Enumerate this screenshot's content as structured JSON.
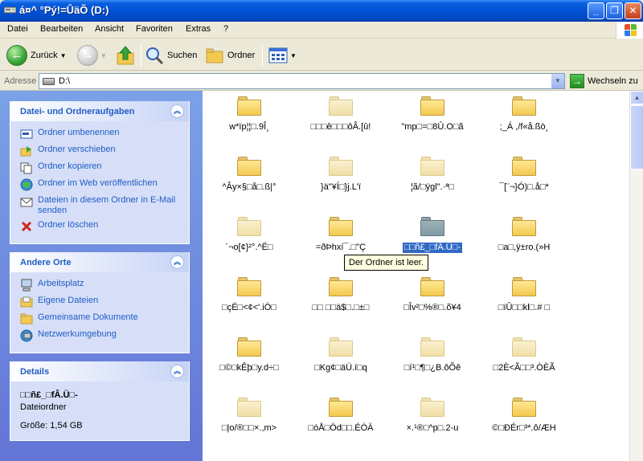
{
  "window": {
    "title": "á¤^ °Pý!=ÛäÕ (D:)",
    "minimize_label": "_",
    "maximize_label": "❐",
    "close_label": "✕"
  },
  "menu": {
    "items": [
      "Datei",
      "Bearbeiten",
      "Ansicht",
      "Favoriten",
      "Extras",
      "?"
    ]
  },
  "toolbar": {
    "back_label": "Zurück",
    "search_label": "Suchen",
    "folders_label": "Ordner"
  },
  "address": {
    "label": "Adresse",
    "value": "D:\\",
    "go_label": "Wechseln zu"
  },
  "tasks": {
    "title": "Datei- und Ordneraufgaben",
    "items": [
      {
        "label": "Ordner umbenennen",
        "icon": "rename-icon"
      },
      {
        "label": "Ordner verschieben",
        "icon": "move-icon"
      },
      {
        "label": "Ordner kopieren",
        "icon": "copy-icon"
      },
      {
        "label": "Ordner im Web veröffentlichen",
        "icon": "web-publish-icon"
      },
      {
        "label": "Dateien in diesem Ordner in E-Mail senden",
        "icon": "email-icon"
      },
      {
        "label": "Ordner löschen",
        "icon": "delete-icon"
      }
    ]
  },
  "other_places": {
    "title": "Andere Orte",
    "items": [
      {
        "label": "Arbeitsplatz",
        "icon": "computer-icon"
      },
      {
        "label": "Eigene Dateien",
        "icon": "documents-icon"
      },
      {
        "label": "Gemeinsame Dokumente",
        "icon": "shared-folder-icon"
      },
      {
        "label": "Netzwerkumgebung",
        "icon": "network-icon"
      }
    ]
  },
  "details": {
    "title": "Details",
    "name": "□□ñ£_□fÂ.Ü□-",
    "type": "Dateiordner",
    "size": "Größe: 1,54 GB"
  },
  "files": [
    {
      "name": "w*ïp¦¦□.9Î¸"
    },
    {
      "name": "□□□ê□□□ôÂ.[û!"
    },
    {
      "name": "\"mp□=□8Û.O□ã"
    },
    {
      "name": ";_Á ,/f«å.ßò¸"
    },
    {
      "name": "^Ây×§□å□.ß|°"
    },
    {
      "name": "}ä\"¥Í□}j.L'ï"
    },
    {
      "name": "¦ã/□ÿgl\".·ª□"
    },
    {
      "name": "¯[¨¬}Ó)□.å□*"
    },
    {
      "name": "´¬o[¢}²°.^Ë□"
    },
    {
      "name": "=ðÞhxí¯.□\"Ç"
    },
    {
      "name": "□□ñ£_□fÂ.Ü□-"
    },
    {
      "name": "□a□,ÿ±ro.(»H"
    },
    {
      "name": "□çË□<¢<'.iÖ□"
    },
    {
      "name": "□□ □□ä$□.□±□"
    },
    {
      "name": "□Îv²□%®□.õ¥4"
    },
    {
      "name": "□ïÛ□□kl□.# □"
    },
    {
      "name": "□©□kÊþ□y.d÷□"
    },
    {
      "name": "□Kg¢□äÜ.í□q"
    },
    {
      "name": "□í¹□¶□¿B.ôÕê"
    },
    {
      "name": "□2È<Ã□□³.ÒÈÃ"
    },
    {
      "name": "□|o/®□□×.,m>"
    },
    {
      "name": "□óÅ□Öd□□.ÉÒÄ"
    },
    {
      "name": "×.¹®□^p□.2-u"
    },
    {
      "name": "©□ÐÉr□³*.ô/ÆH"
    }
  ],
  "tooltip": "Der Ordner ist leer.",
  "colors": {
    "title_blue": "#0052d6",
    "pane_blue": "#6f8de0",
    "link_blue": "#215dc6",
    "selection": "#316ac5"
  }
}
